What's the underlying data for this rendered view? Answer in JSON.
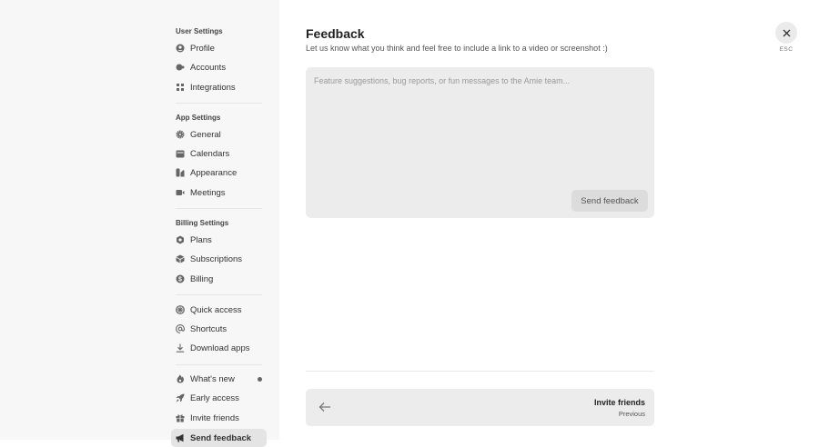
{
  "sidebar": {
    "sections": [
      {
        "heading": "User Settings",
        "items": [
          {
            "label": "Profile",
            "icon": "profile-icon"
          },
          {
            "label": "Accounts",
            "icon": "accounts-icon"
          },
          {
            "label": "Integrations",
            "icon": "integrations-icon"
          }
        ]
      },
      {
        "heading": "App Settings",
        "items": [
          {
            "label": "General",
            "icon": "gear-icon"
          },
          {
            "label": "Calendars",
            "icon": "calendar-icon"
          },
          {
            "label": "Appearance",
            "icon": "appearance-icon"
          },
          {
            "label": "Meetings",
            "icon": "video-icon"
          }
        ]
      },
      {
        "heading": "Billing Settings",
        "items": [
          {
            "label": "Plans",
            "icon": "plans-icon"
          },
          {
            "label": "Subscriptions",
            "icon": "box-icon"
          },
          {
            "label": "Billing",
            "icon": "dollar-icon"
          }
        ]
      },
      {
        "items": [
          {
            "label": "Quick access",
            "icon": "quick-access-icon"
          },
          {
            "label": "Shortcuts",
            "icon": "at-icon"
          },
          {
            "label": "Download apps",
            "icon": "download-icon"
          }
        ]
      },
      {
        "items": [
          {
            "label": "What's new",
            "icon": "flame-icon"
          },
          {
            "label": "Early access",
            "icon": "rocket-icon"
          },
          {
            "label": "Invite friends",
            "icon": "gift-icon"
          },
          {
            "label": "Send feedback",
            "icon": "megaphone-icon",
            "active": true
          }
        ]
      }
    ]
  },
  "main": {
    "title": "Feedback",
    "subtitle": "Let us know what you think and feel free to include a link to a video or screenshot :)",
    "placeholder": "Feature suggestions, bug reports, or fun messages to the Amie team...",
    "send_label": "Send feedback",
    "nav": {
      "title": "Invite friends",
      "subtitle": "Previous"
    }
  },
  "close": {
    "esc_label": "ESC"
  }
}
